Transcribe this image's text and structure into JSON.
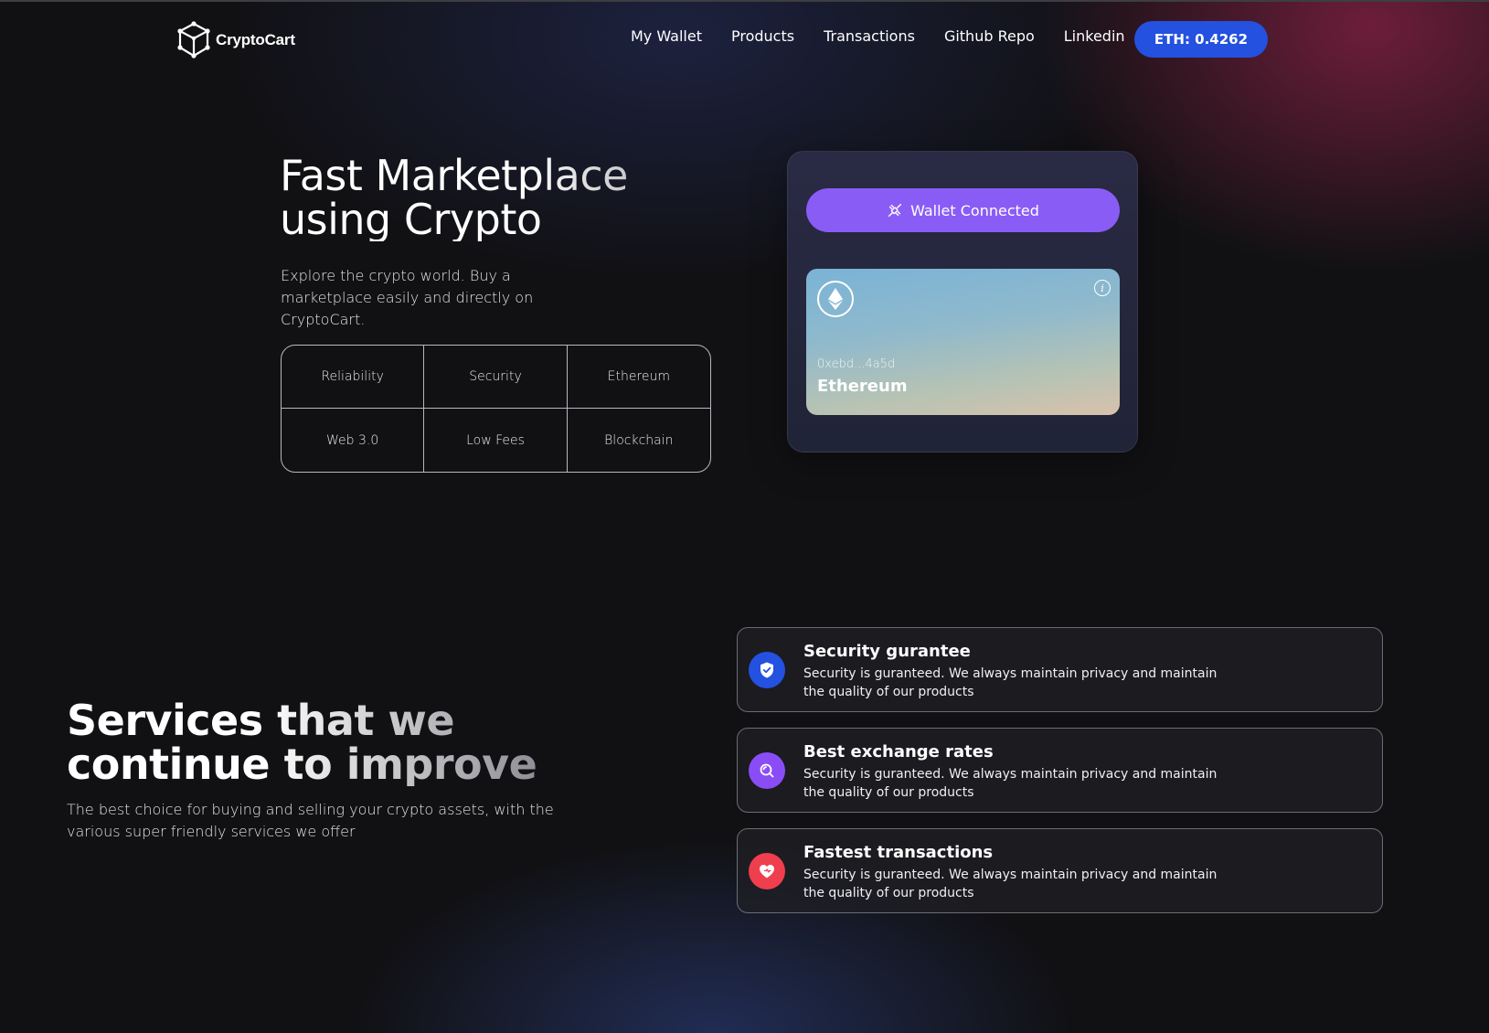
{
  "brand": {
    "name": "CryptoCart",
    "logo_icon": "cube-icon"
  },
  "nav": {
    "links": [
      "My Wallet",
      "Products",
      "Transactions",
      "Github Repo",
      "Linkedin"
    ],
    "eth_balance": "ETH: 0.4262"
  },
  "hero": {
    "title_line1": "Fast Marketplace",
    "title_line2": "using Crypto",
    "subtitle": "Explore the crypto world. Buy a marketplace easily and directly on CryptoCart.",
    "features": [
      "Reliability",
      "Security",
      "Ethereum",
      "Web 3.0",
      "Low Fees",
      "Blockchain"
    ]
  },
  "wallet": {
    "button_label": "Wallet Connected",
    "button_icon": "plug-icon",
    "card": {
      "address": "0xebd...4a5d",
      "network": "Ethereum",
      "icon": "ethereum-icon",
      "info_icon": "info-icon"
    }
  },
  "services": {
    "title_line1": "Services that we",
    "title_line2": "continue to improve",
    "subtitle": "The best choice for buying and selling your crypto assets, with the various super friendly services we offer",
    "items": [
      {
        "title": "Security gurantee",
        "description": "Security is guranteed. We always maintain privacy and maintain the quality of our products",
        "icon": "shield-check-icon",
        "color": "#2451e0"
      },
      {
        "title": "Best exchange rates",
        "description": "Security is guranteed. We always maintain privacy and maintain the quality of our products",
        "icon": "search-icon",
        "color": "#8a4df5"
      },
      {
        "title": "Fastest transactions",
        "description": "Security is guranteed. We always maintain privacy and maintain the quality of our products",
        "icon": "heart-icon",
        "color": "#ef3e4d"
      }
    ]
  },
  "colors": {
    "accent_blue": "#2451e0",
    "accent_purple": "#8a5cf6",
    "background": "#111114"
  }
}
